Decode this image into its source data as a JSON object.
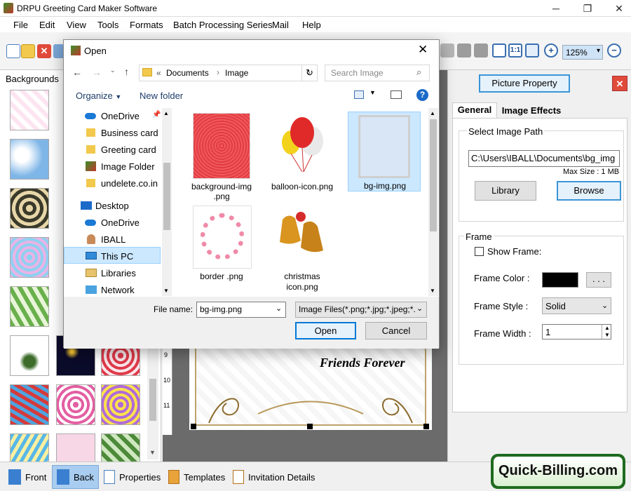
{
  "window": {
    "title": "DRPU Greeting Card Maker Software",
    "min": "─",
    "max": "❐",
    "close": "✕"
  },
  "menu": [
    "File",
    "Edit",
    "View",
    "Tools",
    "Formats",
    "Batch Processing Series",
    "Mail",
    "Help"
  ],
  "toolbar": {
    "zoom": "125%"
  },
  "left_panel": {
    "title": "Backgrounds"
  },
  "card": {
    "text": "Friends Forever"
  },
  "ruler": {
    "ticks": [
      "9",
      "10",
      "11"
    ]
  },
  "right_panel": {
    "header_button": "Picture Property",
    "tabs": [
      "General",
      "Image Effects"
    ],
    "image_path_label": "Select Image Path",
    "image_path_value": "C:\\Users\\IBALL\\Documents\\bg_img",
    "max_size": "Max Size : 1 MB",
    "library_button": "Library",
    "browse_button": "Browse",
    "frame_group": "Frame",
    "show_frame": "Show Frame:",
    "frame_color_label": "Frame Color :",
    "frame_color_value": "#000000",
    "frame_color_more": ". . .",
    "frame_style_label": "Frame Style :",
    "frame_style_value": "Solid",
    "frame_width_label": "Frame Width :",
    "frame_width_value": "1"
  },
  "bottom_tabs": [
    "Front",
    "Back",
    "Properties",
    "Templates",
    "Invitation Details"
  ],
  "watermark": "Quick-Billing.com",
  "dialog": {
    "title": "Open",
    "breadcrumb_prefix": "«",
    "breadcrumb": [
      "Documents",
      "Image"
    ],
    "search_placeholder": "Search Image",
    "organize": "Organize",
    "new_folder": "New folder",
    "nav": [
      "OneDrive",
      "Business card",
      "Greeting card",
      "Image Folder",
      "undelete.co.in",
      "Desktop",
      "OneDrive",
      "IBALL",
      "This PC",
      "Libraries",
      "Network"
    ],
    "files": [
      {
        "name": "background-img .png"
      },
      {
        "name": "balloon-icon.png"
      },
      {
        "name": "bg-img.png"
      },
      {
        "name": "border .png"
      },
      {
        "name": "christmas icon.png"
      }
    ],
    "filename_label": "File name:",
    "filename_value": "bg-img.png",
    "filetype_value": "Image Files(*.png;*.jpg;*.jpeg;*.",
    "open_button": "Open",
    "cancel_button": "Cancel"
  }
}
